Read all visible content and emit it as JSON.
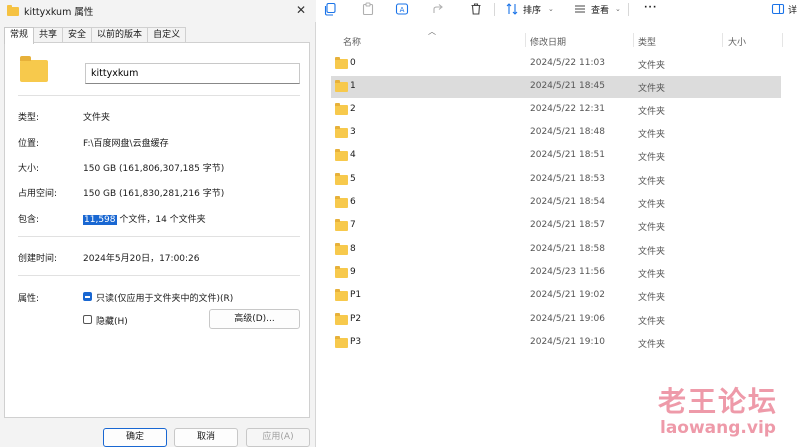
{
  "dialog": {
    "title": "kittyxkum 属性",
    "close_glyph": "✕",
    "tabs": [
      "常规",
      "共享",
      "安全",
      "以前的版本",
      "自定义"
    ],
    "name_value": "kittyxkum",
    "props": {
      "type_label": "类型:",
      "type_value": "文件夹",
      "location_label": "位置:",
      "location_value": "F:\\百度网盘\\云盘缓存",
      "size_label": "大小:",
      "size_value": "150 GB (161,806,307,185 字节)",
      "disk_label": "占用空间:",
      "disk_value": "150 GB (161,830,281,216 字节)",
      "contains_label": "包含:",
      "contains_files": "11,598",
      "contains_rest": " 个文件，14 个文件夹",
      "created_label": "创建时间:",
      "created_value": "2024年5月20日，17:00:26",
      "attributes_label": "属性:",
      "readonly_label": "只读(仅应用于文件夹中的文件)(R)",
      "hidden_label": "隐藏(H)",
      "advanced_label": "高级(D)..."
    },
    "buttons": {
      "ok": "确定",
      "cancel": "取消",
      "apply": "应用(A)"
    }
  },
  "toolbar": {
    "sort_label": "排序",
    "view_label": "查看",
    "more_glyph": "···",
    "details_label": "详"
  },
  "columns": {
    "name": "名称",
    "modified": "修改日期",
    "type": "类型",
    "size": "大小"
  },
  "files": [
    {
      "name": "0",
      "modified": "2024/5/22 11:03",
      "type": "文件夹"
    },
    {
      "name": "1",
      "modified": "2024/5/21 18:45",
      "type": "文件夹"
    },
    {
      "name": "2",
      "modified": "2024/5/22 12:31",
      "type": "文件夹"
    },
    {
      "name": "3",
      "modified": "2024/5/21 18:48",
      "type": "文件夹"
    },
    {
      "name": "4",
      "modified": "2024/5/21 18:51",
      "type": "文件夹"
    },
    {
      "name": "5",
      "modified": "2024/5/21 18:53",
      "type": "文件夹"
    },
    {
      "name": "6",
      "modified": "2024/5/21 18:54",
      "type": "文件夹"
    },
    {
      "name": "7",
      "modified": "2024/5/21 18:57",
      "type": "文件夹"
    },
    {
      "name": "8",
      "modified": "2024/5/21 18:58",
      "type": "文件夹"
    },
    {
      "name": "9",
      "modified": "2024/5/23 11:56",
      "type": "文件夹"
    },
    {
      "name": "P1",
      "modified": "2024/5/21 19:02",
      "type": "文件夹"
    },
    {
      "name": "P2",
      "modified": "2024/5/21 19:06",
      "type": "文件夹"
    },
    {
      "name": "P3",
      "modified": "2024/5/21 19:10",
      "type": "文件夹"
    }
  ],
  "watermark": {
    "title": "老王论坛",
    "url": "laowang.vip"
  }
}
